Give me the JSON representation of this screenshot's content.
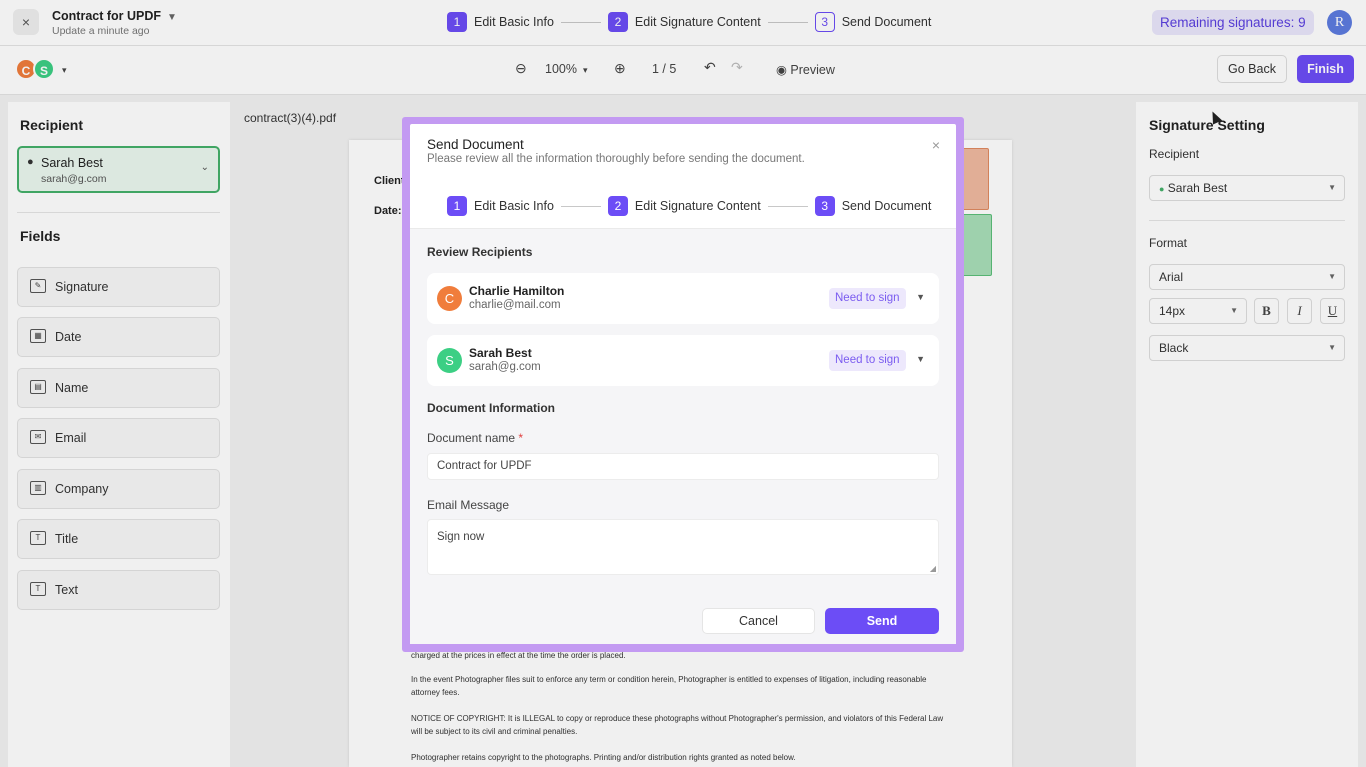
{
  "header": {
    "close_icon": "×",
    "doc_title": "Contract for UPDF",
    "doc_subtitle": "Update a minute ago",
    "steps": [
      {
        "num": "1",
        "label": "Edit Basic Info"
      },
      {
        "num": "2",
        "label": "Edit Signature Content"
      },
      {
        "num": "3",
        "label": "Send Document"
      }
    ],
    "remaining": "Remaining signatures: 9",
    "avatar_initial": "R"
  },
  "toolbar": {
    "avatars": [
      "C",
      "S"
    ],
    "zoom": "100%",
    "page_indicator": "1 / 5",
    "preview_label": "Preview",
    "go_back_label": "Go Back",
    "finish_label": "Finish"
  },
  "left_panel": {
    "recipient_heading": "Recipient",
    "selected_recipient": {
      "name": "Sarah Best",
      "email": "sarah@g.com"
    },
    "fields_heading": "Fields",
    "fields": [
      {
        "label": "Signature",
        "icon": "signature-icon"
      },
      {
        "label": "Date",
        "icon": "calendar-icon"
      },
      {
        "label": "Name",
        "icon": "name-card-icon"
      },
      {
        "label": "Email",
        "icon": "envelope-icon"
      },
      {
        "label": "Company",
        "icon": "building-icon"
      },
      {
        "label": "Title",
        "icon": "title-icon"
      },
      {
        "label": "Text",
        "icon": "text-icon"
      }
    ]
  },
  "document": {
    "filename": "contract(3)(4).pdf",
    "client_label": "Client",
    "date_label": "Date:",
    "paragraphs": [
      "charged at the prices in effect at the time the order is placed.",
      "In the event Photographer files suit to enforce any term or condition herein, Photographer is entitled to expenses of litigation, including reasonable attorney fees.",
      "NOTICE OF COPYRIGHT: It is ILLEGAL to copy or reproduce these photographs without Photographer's permission, and violators of this Federal Law will be subject to its civil and criminal penalties.",
      "Photographer retains copyright to the photographs. Printing and/or distribution rights granted as noted below."
    ]
  },
  "right_panel": {
    "heading": "Signature Setting",
    "recipient_label": "Recipient",
    "recipient_value": "Sarah Best",
    "format_label": "Format",
    "font_value": "Arial",
    "size_value": "14px",
    "bold": "B",
    "italic": "I",
    "underline": "U",
    "color_value": "Black"
  },
  "modal": {
    "title": "Send Document",
    "subtitle": "Please review all the information thoroughly before sending the document.",
    "close_icon": "×",
    "review_heading": "Review Recipients",
    "recipients": [
      {
        "initial": "C",
        "name": "Charlie Hamilton",
        "email": "charlie@mail.com",
        "role": "Need to sign",
        "color": "#f07d3c"
      },
      {
        "initial": "S",
        "name": "Sarah Best",
        "email": "sarah@g.com",
        "role": "Need to sign",
        "color": "#3ccf84"
      }
    ],
    "doc_info_heading": "Document Information",
    "doc_name_label": "Document name",
    "required_mark": "*",
    "doc_name_value": "Contract for UPDF",
    "email_msg_label": "Email Message",
    "email_msg_value": "Sign now",
    "cancel_label": "Cancel",
    "send_label": "Send"
  },
  "colors": {
    "accent": "#6c4df6",
    "success": "#44b06a",
    "charlie": "#f07d3c",
    "sarah": "#3ccf84"
  }
}
